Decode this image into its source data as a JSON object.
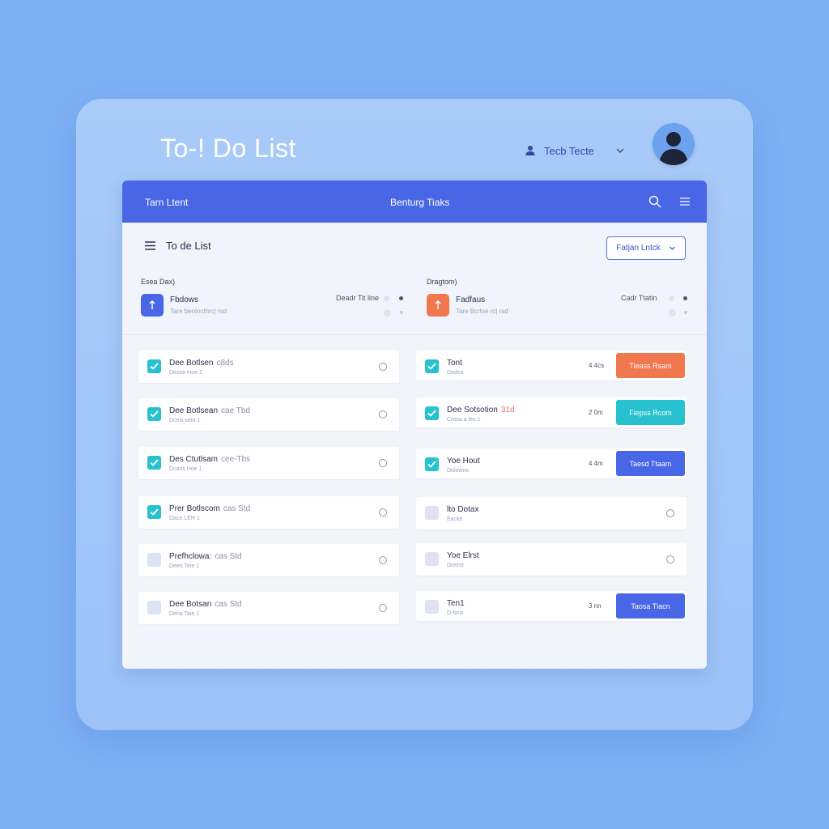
{
  "app": {
    "title": "To-! Do List",
    "user_label": "Tecb Tecte",
    "colors": {
      "accent": "#4866e5",
      "teal": "#27c1cf",
      "orange": "#f1774e",
      "background": "#7eb0f5"
    }
  },
  "topbar": {
    "left_label": "Tarn Ltent",
    "center_label": "Benturg Tiaks"
  },
  "subheader": {
    "title": "To de List",
    "dropdown_label": "Fatjan Lntck"
  },
  "categories": [
    {
      "label": "Esea Dax)",
      "name": "Fbdows",
      "sub": "Tare beoincthrc| rsd",
      "right": "Deadr Tit line",
      "icon": "arrow-up-icon",
      "color": "#4866e5"
    },
    {
      "label": "Dragtom)",
      "name": "Fadfaus",
      "sub": "Tare Bcrtse rc| rsd",
      "right": "Cadr Ttatin",
      "icon": "arrow-up-icon",
      "color": "#f1774e"
    }
  ],
  "left_tasks": [
    {
      "title": "Dee Botlsen",
      "extra": "c8ds",
      "sub": "Deose Hoe 1",
      "checked": true
    },
    {
      "title": "Dee Botlsean",
      "extra": "cae Tbd",
      "sub": "Dceis seia 1",
      "checked": true
    },
    {
      "title": "Des Ctutlsam",
      "extra": "cee-Tbs",
      "sub": "Dcans Hoe 1",
      "checked": true
    },
    {
      "title": "Prer Botlscom",
      "extra": "cas Std",
      "sub": "Dace LEH 1",
      "checked": true
    },
    {
      "title": "Prefhclowa:",
      "extra": "cas Std",
      "sub": "Deen Teie 1",
      "checked": false
    },
    {
      "title": "Dee Botsan",
      "extra": "cas Std",
      "sub": "Deha Taie 1",
      "checked": false
    }
  ],
  "right_tasks": [
    {
      "title": "Tont",
      "extra": "",
      "sub": "Dodca",
      "checked": true,
      "time": "4 4cs",
      "action": "Tieass Rsam",
      "action_color": "#f1774e"
    },
    {
      "title": "Dee Sotsotion",
      "extra": "31d",
      "sub": "Crosa a leu 1",
      "checked": true,
      "time": "2 0m",
      "action": "Fiepss Rcom",
      "action_color": "#27c1cf"
    },
    {
      "title": "Yoe Hout",
      "extra": "",
      "sub": "Dolowns",
      "checked": true,
      "time": "4 4m",
      "action": "Taesd Ttaam",
      "action_color": "#4866e5"
    },
    {
      "title": "lto Dotax",
      "extra": "",
      "sub": "Eacke",
      "checked": false,
      "time": "",
      "action": "",
      "action_color": ""
    },
    {
      "title": "Yoe Elrst",
      "extra": "",
      "sub": "Drien0",
      "checked": false,
      "time": "",
      "action": "",
      "action_color": ""
    },
    {
      "title": "Ten1",
      "extra": "",
      "sub": "D-fons",
      "checked": false,
      "time": "3 nn",
      "action": "Taosa Tlacn",
      "action_color": "#4866e5"
    }
  ]
}
